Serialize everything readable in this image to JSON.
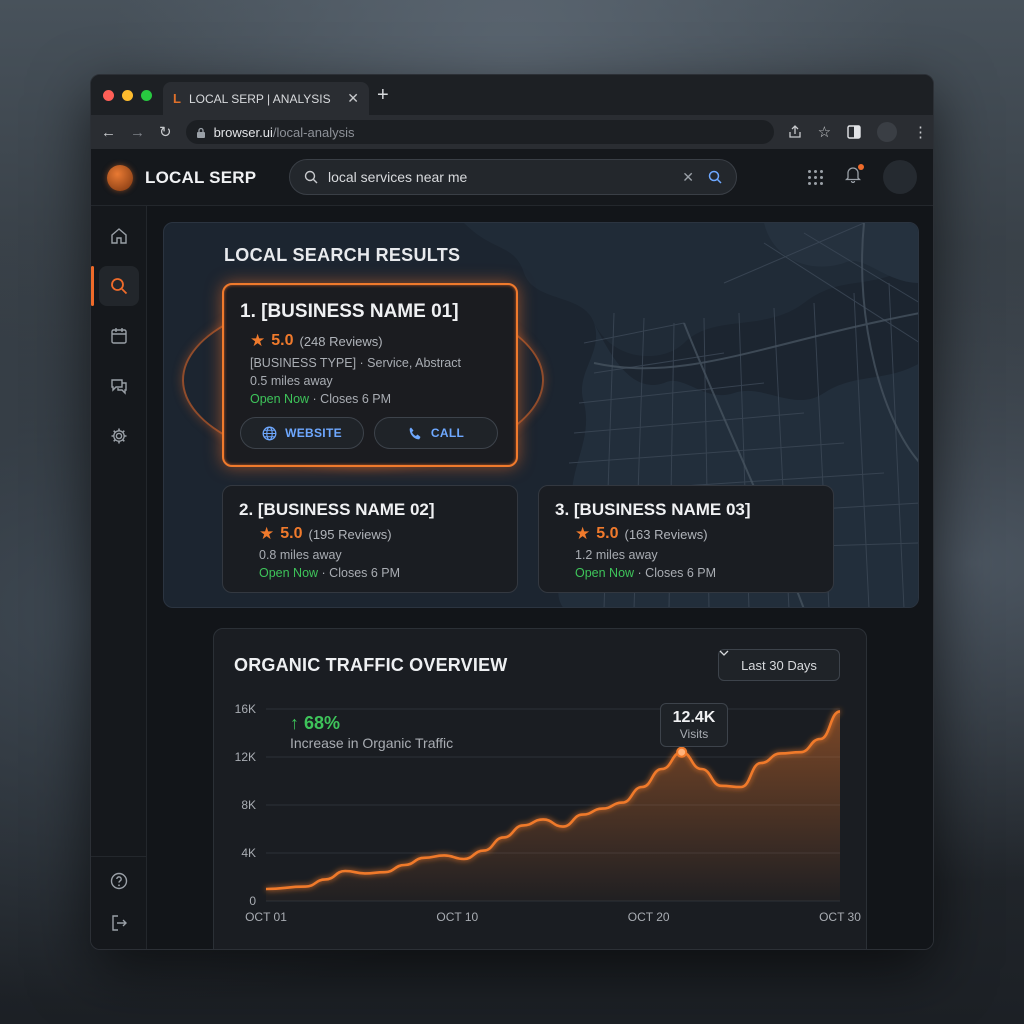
{
  "browser": {
    "tab_title": "LOCAL SERP | ANALYSIS",
    "tab_icon_letter": "L",
    "url_host": "browser.ui",
    "url_path": "/local-analysis"
  },
  "app": {
    "brand": "LOCAL SERP",
    "search_value": "local services near me"
  },
  "colors": {
    "accent": "#F07A2C",
    "positive": "#3EC45A",
    "link": "#6EA8FF"
  },
  "sidebar": {
    "items": [
      {
        "icon": "home-icon"
      },
      {
        "icon": "search-icon",
        "active": true
      },
      {
        "icon": "calendar-icon"
      },
      {
        "icon": "chat-icon"
      },
      {
        "icon": "gear-icon"
      }
    ],
    "bottom": [
      {
        "icon": "help-icon"
      },
      {
        "icon": "logout-icon"
      }
    ]
  },
  "local_results": {
    "title": "LOCAL SEARCH RESULTS",
    "featured": {
      "title": "1. [BUSINESS NAME 01]",
      "rating": "5.0",
      "reviews": "(248 Reviews)",
      "type": "[BUSINESS TYPE] · Service, Abstract",
      "distance": "0.5 miles away",
      "open": "Open Now",
      "hours": "· Closes 6 PM",
      "website_label": "WEBSITE",
      "call_label": "CALL"
    },
    "others": [
      {
        "title": "2. [BUSINESS NAME 02]",
        "rating": "5.0",
        "reviews": "(195 Reviews)",
        "distance": "0.8 miles away",
        "open": "Open Now",
        "hours": "· Closes 6 PM"
      },
      {
        "title": "3. [BUSINESS NAME 03]",
        "rating": "5.0",
        "reviews": "(163 Reviews)",
        "distance": "1.2 miles away",
        "open": "Open Now",
        "hours": "· Closes 6 PM"
      }
    ]
  },
  "traffic": {
    "title": "ORGANIC TRAFFIC OVERVIEW",
    "range_label": "Last 30 Days",
    "stat_value": "↑ 68%",
    "stat_label": "Increase in Organic Traffic",
    "tooltip_value": "12.4K",
    "tooltip_label": "Visits"
  },
  "chart_data": {
    "type": "area",
    "title": "ORGANIC TRAFFIC OVERVIEW",
    "x_tick_labels": [
      "OCT 01",
      "OCT 10",
      "OCT 20",
      "OCT 30"
    ],
    "y_tick_labels": [
      "0",
      "4K",
      "8K",
      "12K",
      "16K"
    ],
    "ylim": [
      0,
      16000
    ],
    "xlim": [
      1,
      30
    ],
    "grid": true,
    "series": [
      {
        "x": [
          1,
          3,
          4,
          5,
          6,
          7,
          8,
          9,
          10,
          11,
          12,
          13,
          14,
          15,
          16,
          17,
          18,
          19,
          20,
          21,
          22,
          23,
          24,
          25,
          26,
          27,
          28,
          29,
          30
        ],
        "values": [
          1000,
          1200,
          1800,
          2500,
          2300,
          2400,
          3000,
          3600,
          3800,
          3500,
          4200,
          5300,
          6300,
          6800,
          6200,
          7200,
          7700,
          8200,
          9500,
          11000,
          12400,
          11000,
          9600,
          9500,
          11500,
          12300,
          12400,
          13500,
          15800
        ]
      }
    ],
    "highlight": {
      "x": 22,
      "y": 12400,
      "label": "12.4K",
      "sublabel": "Visits"
    }
  }
}
